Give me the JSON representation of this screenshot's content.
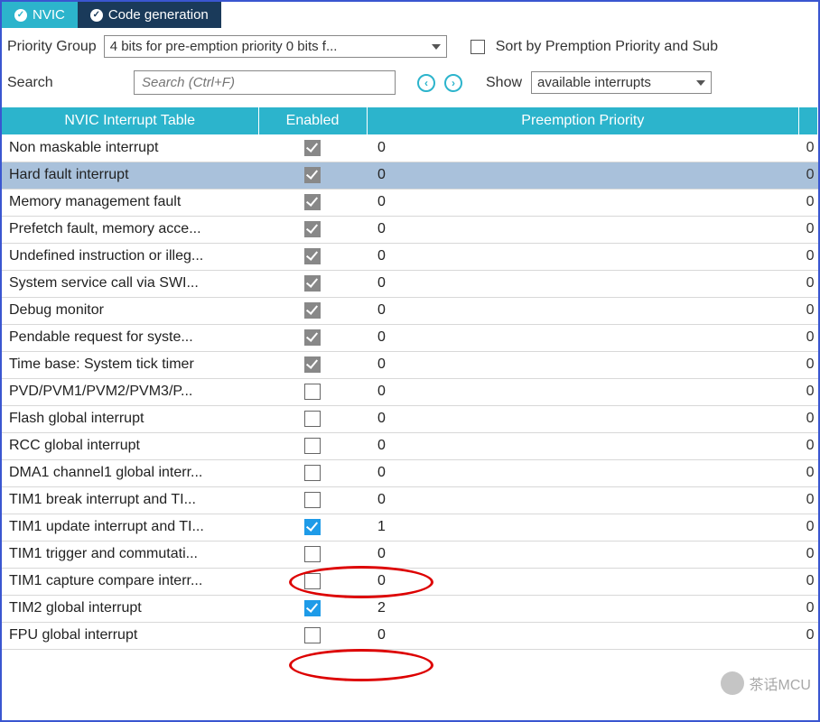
{
  "tabs": {
    "nvic": "NVIC",
    "codegen": "Code generation"
  },
  "toolbar": {
    "priority_group_label": "Priority Group",
    "priority_group_value": "4 bits for pre-emption priority 0 bits f...",
    "sort_label": "Sort by Premption Priority and Sub",
    "search_label": "Search",
    "search_placeholder": "Search (Ctrl+F)",
    "show_label": "Show",
    "show_value": "available interrupts"
  },
  "table": {
    "headers": {
      "name": "NVIC Interrupt Table",
      "enabled": "Enabled",
      "preemption": "Preemption Priority"
    },
    "rows": [
      {
        "name": "Non maskable interrupt",
        "enabled": true,
        "locked": true,
        "pre": "0",
        "sub": "0",
        "selected": false
      },
      {
        "name": "Hard fault interrupt",
        "enabled": true,
        "locked": true,
        "pre": "0",
        "sub": "0",
        "selected": true
      },
      {
        "name": "Memory management fault",
        "enabled": true,
        "locked": true,
        "pre": "0",
        "sub": "0",
        "selected": false
      },
      {
        "name": "Prefetch fault, memory acce...",
        "enabled": true,
        "locked": true,
        "pre": "0",
        "sub": "0",
        "selected": false
      },
      {
        "name": "Undefined instruction or illeg...",
        "enabled": true,
        "locked": true,
        "pre": "0",
        "sub": "0",
        "selected": false
      },
      {
        "name": "System service call via SWI...",
        "enabled": true,
        "locked": true,
        "pre": "0",
        "sub": "0",
        "selected": false
      },
      {
        "name": "Debug monitor",
        "enabled": true,
        "locked": true,
        "pre": "0",
        "sub": "0",
        "selected": false
      },
      {
        "name": "Pendable request for syste...",
        "enabled": true,
        "locked": true,
        "pre": "0",
        "sub": "0",
        "selected": false
      },
      {
        "name": "Time base: System tick timer",
        "enabled": true,
        "locked": true,
        "pre": "0",
        "sub": "0",
        "selected": false
      },
      {
        "name": "PVD/PVM1/PVM2/PVM3/P...",
        "enabled": false,
        "locked": false,
        "pre": "0",
        "sub": "0",
        "selected": false
      },
      {
        "name": "Flash global interrupt",
        "enabled": false,
        "locked": false,
        "pre": "0",
        "sub": "0",
        "selected": false
      },
      {
        "name": "RCC global interrupt",
        "enabled": false,
        "locked": false,
        "pre": "0",
        "sub": "0",
        "selected": false
      },
      {
        "name": "DMA1 channel1 global interr...",
        "enabled": false,
        "locked": false,
        "pre": "0",
        "sub": "0",
        "selected": false
      },
      {
        "name": "TIM1 break interrupt and TI...",
        "enabled": false,
        "locked": false,
        "pre": "0",
        "sub": "0",
        "selected": false
      },
      {
        "name": "TIM1 update interrupt and TI...",
        "enabled": true,
        "locked": false,
        "pre": "1",
        "sub": "0",
        "selected": false
      },
      {
        "name": "TIM1 trigger and commutati...",
        "enabled": false,
        "locked": false,
        "pre": "0",
        "sub": "0",
        "selected": false
      },
      {
        "name": "TIM1 capture compare interr...",
        "enabled": false,
        "locked": false,
        "pre": "0",
        "sub": "0",
        "selected": false
      },
      {
        "name": "TIM2 global interrupt",
        "enabled": true,
        "locked": false,
        "pre": "2",
        "sub": "0",
        "selected": false
      },
      {
        "name": "FPU global interrupt",
        "enabled": false,
        "locked": false,
        "pre": "0",
        "sub": "0",
        "selected": false
      }
    ]
  },
  "watermark": "茶话MCU"
}
